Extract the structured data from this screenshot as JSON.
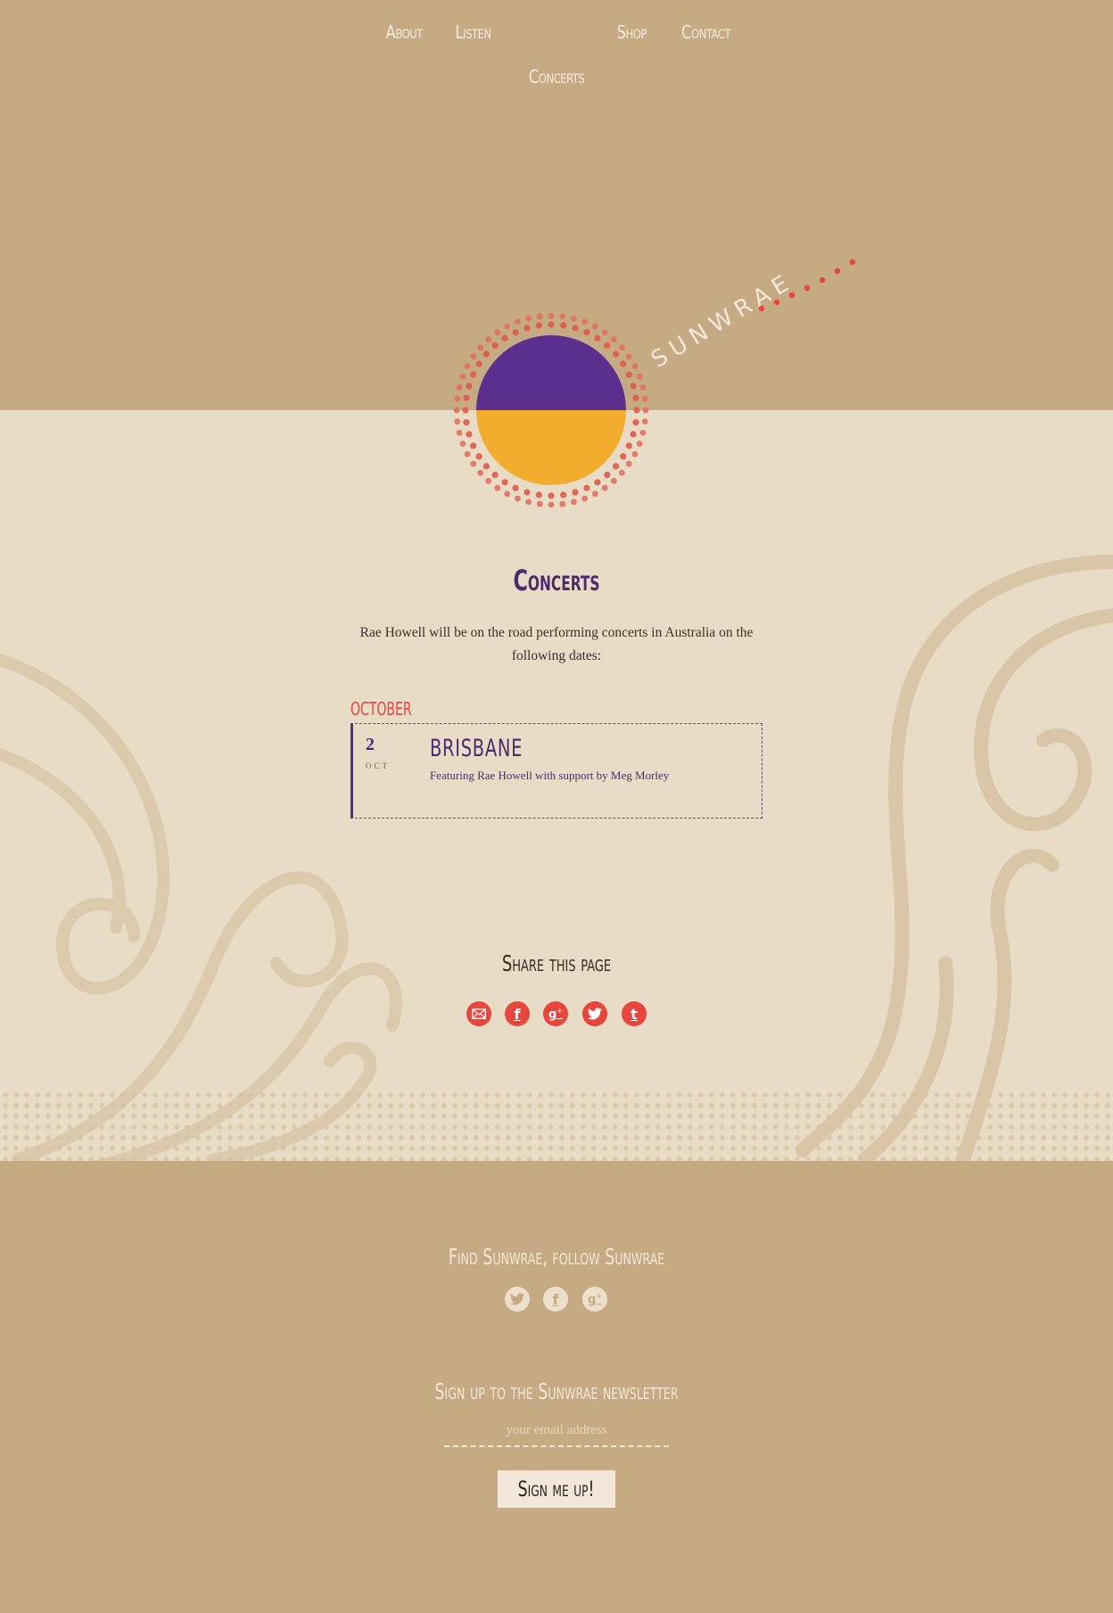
{
  "nav": {
    "about": "About",
    "listen": "Listen",
    "shop": "Shop",
    "contact": "Contact",
    "concerts": "Concerts"
  },
  "logo": {
    "wordmark": "SUNWRAE",
    "colors": {
      "top": "#5a2f8e",
      "bottom": "#f2ad2f",
      "dots": "#e8453c"
    }
  },
  "main": {
    "title": "Concerts",
    "intro": "Rae Howell will be on the road performing concerts in Australia on the following dates:",
    "month": "OCTOBER",
    "events": [
      {
        "day": "2",
        "month_short": "OCT",
        "city": "BRISBANE",
        "description": "Featuring Rae Howell with support by Meg Morley"
      }
    ]
  },
  "share": {
    "title": "Share this page",
    "icons": [
      "email-icon",
      "facebook-icon",
      "google-plus-icon",
      "twitter-icon",
      "tumblr-icon"
    ],
    "color": "#e8453c"
  },
  "footer": {
    "follow_title": "Find Sunwrae, follow Sunwrae",
    "follow_icons": [
      "twitter-icon",
      "facebook-icon",
      "google-plus-icon"
    ],
    "newsletter_title": "Sign up to the Sunwrae newsletter",
    "email_placeholder": "your email address",
    "signup_label": "Sign me up!"
  }
}
